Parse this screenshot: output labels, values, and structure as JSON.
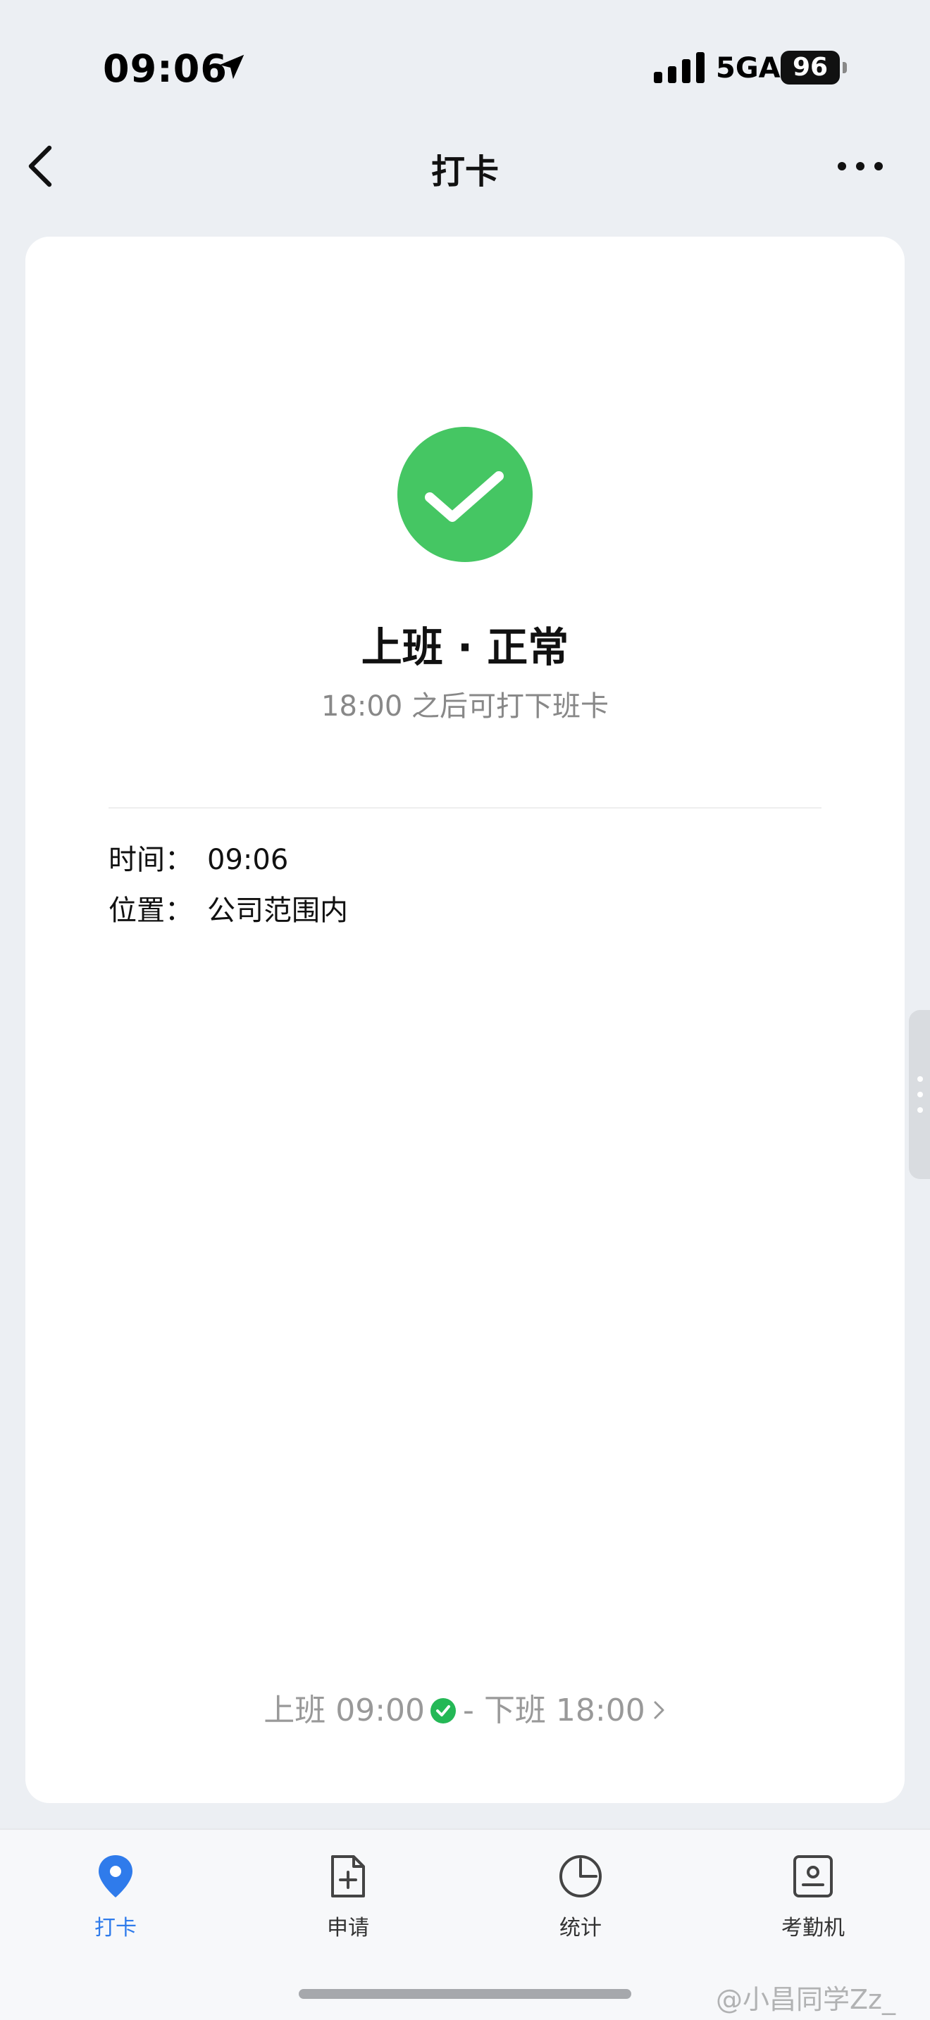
{
  "status_bar": {
    "time": "09:06",
    "network": "5GA",
    "battery": "96"
  },
  "nav": {
    "title": "打卡"
  },
  "card": {
    "status_title": "上班 · 正常",
    "status_subtitle": "18:00 之后可打下班卡",
    "info": [
      {
        "label": "时间：",
        "value": "09:06"
      },
      {
        "label": "位置：",
        "value": "公司范围内"
      }
    ],
    "schedule": {
      "on_duty": "上班 09:00",
      "separator": "-",
      "off_duty": "下班 18:00"
    }
  },
  "tabs": [
    {
      "label": "打卡",
      "icon": "location-pin-icon",
      "active": true
    },
    {
      "label": "申请",
      "icon": "document-add-icon",
      "active": false
    },
    {
      "label": "统计",
      "icon": "pie-chart-icon",
      "active": false
    },
    {
      "label": "考勤机",
      "icon": "attendance-device-icon",
      "active": false
    }
  ],
  "watermark": "@小昌同学Zz_",
  "colors": {
    "accent": "#2F7BEB",
    "success": "#45C663",
    "background": "#ECEFF3"
  }
}
